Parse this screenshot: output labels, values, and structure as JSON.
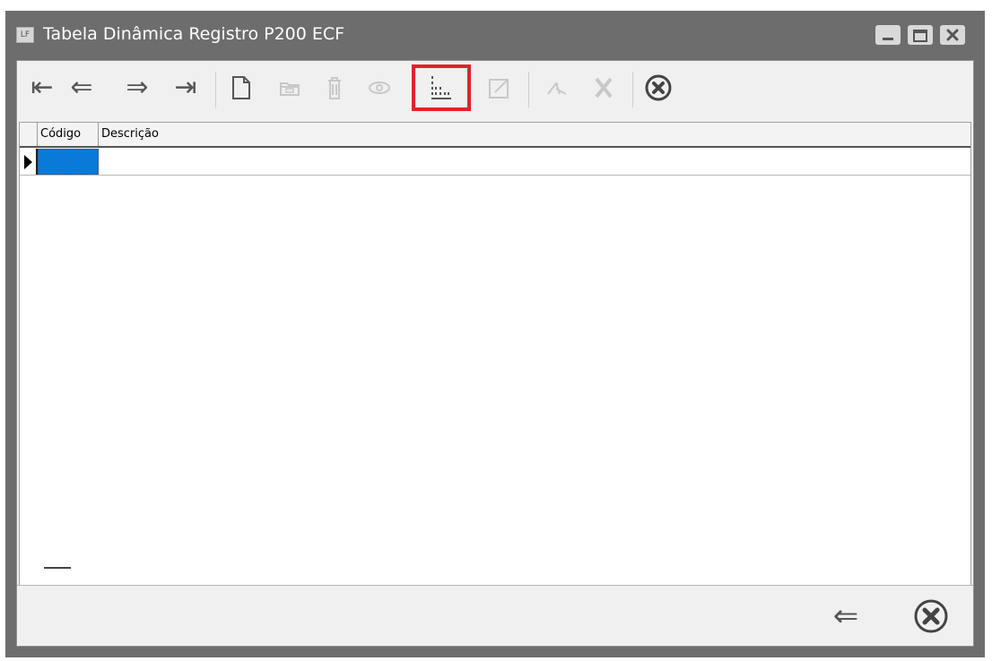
{
  "window": {
    "title": "Tabela Dinâmica Registro P200 ECF",
    "app_icon_label": "LF"
  },
  "toolbar": {
    "buttons": [
      {
        "name": "first-record",
        "icon": "arrow-to-start-icon",
        "glyph": "⇤",
        "enabled": true
      },
      {
        "name": "previous-record",
        "icon": "arrow-left-icon",
        "glyph": "⇐",
        "enabled": true
      },
      {
        "name": "next-record",
        "icon": "arrow-right-icon",
        "glyph": "⇒",
        "enabled": true
      },
      {
        "name": "last-record",
        "icon": "arrow-to-end-icon",
        "glyph": "⇥",
        "enabled": true
      },
      {
        "name": "new-record",
        "icon": "new-document-icon",
        "enabled": true
      },
      {
        "name": "copy-record",
        "icon": "folder-icon",
        "enabled": false
      },
      {
        "name": "delete-record",
        "icon": "trash-icon",
        "enabled": false
      },
      {
        "name": "view-record",
        "icon": "eye-icon",
        "enabled": false
      },
      {
        "name": "pivot-table",
        "icon": "pivot-table-icon",
        "enabled": true,
        "highlighted": true
      },
      {
        "name": "edit-record",
        "icon": "edit-icon",
        "enabled": false
      },
      {
        "name": "confirm",
        "icon": "check-icon",
        "enabled": false
      },
      {
        "name": "cancel",
        "icon": "x-icon",
        "enabled": false
      },
      {
        "name": "close",
        "icon": "close-circle-icon",
        "enabled": true
      }
    ],
    "highlight_color": "#e3212b"
  },
  "grid": {
    "columns": [
      "Código",
      "Descrição"
    ],
    "rows": [
      {
        "codigo": "",
        "descricao": ""
      }
    ],
    "selection_color": "#0a7ad8"
  },
  "footer": {
    "navigator_glyph": "—"
  },
  "bottom_buttons": [
    {
      "name": "back",
      "icon": "arrow-left-icon",
      "glyph": "⇐"
    },
    {
      "name": "close",
      "icon": "close-circle-icon"
    }
  ]
}
